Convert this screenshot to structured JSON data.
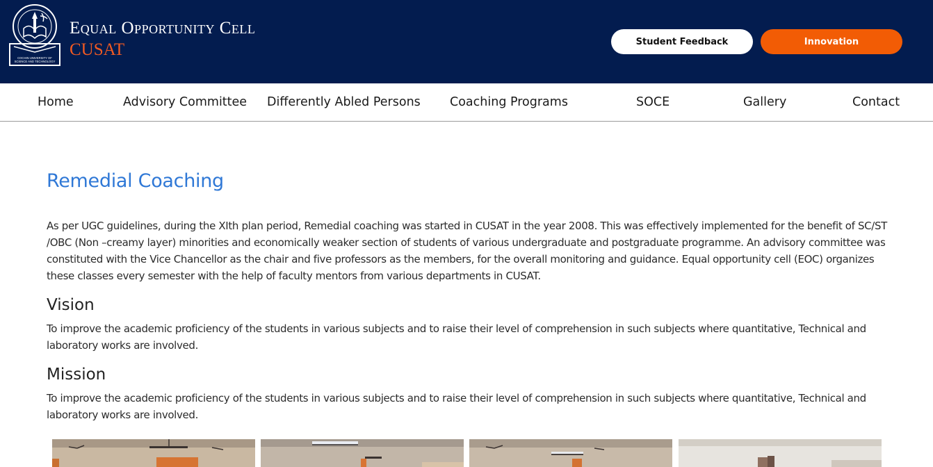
{
  "header": {
    "title": "Equal Opportunity Cell",
    "subtitle": "CUSAT",
    "logo_text": "COCHIN UNIVERSITY OF SCIENCE AND TECHNOLOGY",
    "buttons": {
      "feedback": "Student Feedback",
      "innovation": "Innovation"
    }
  },
  "nav": {
    "items": [
      "Home",
      "Advisory Committee",
      "Differently Abled Persons",
      "Coaching Programs",
      "SOCE",
      "Gallery",
      "Contact"
    ]
  },
  "main": {
    "title": "Remedial Coaching",
    "intro": "As per UGC guidelines, during the XIth plan period, Remedial coaching was started in CUSAT in the year 2008. This was effectively implemented for the benefit of   SC/ST /OBC (Non –creamy layer) minorities and economically weaker section of students of various undergraduate and postgraduate programme.  An advisory committee was constituted with the Vice Chancellor as the chair and five professors as the members, for the overall monitoring and guidance. Equal opportunity cell (EOC) organizes these classes every semester with the help of faculty mentors from various departments in CUSAT.",
    "vision_heading": "Vision",
    "vision_text": "To improve the academic proficiency of the students in various subjects and to raise their level of comprehension in such subjects where quantitative, Technical and laboratory works are involved.",
    "mission_heading": "Mission",
    "mission_text": "To improve the academic proficiency of the students in various subjects and to raise their level of comprehension in such subjects where quantitative, Technical and laboratory works are involved."
  },
  "colors": {
    "header_bg": "#031c4f",
    "accent_orange": "#f25c05",
    "title_blue": "#2f78d6"
  }
}
